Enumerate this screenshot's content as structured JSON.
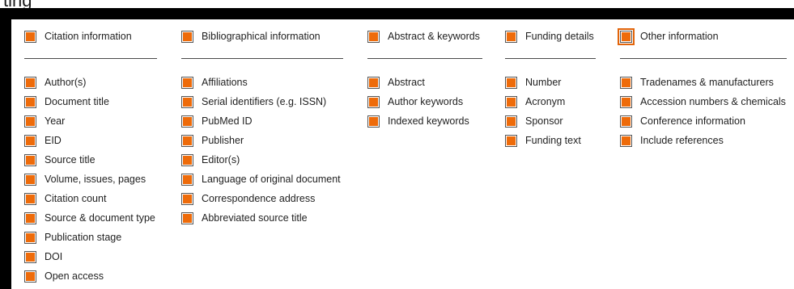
{
  "page": {
    "heading": "ting"
  },
  "columns": [
    {
      "header": "Citation information",
      "items": [
        "Author(s)",
        "Document title",
        "Year",
        "EID",
        "Source title",
        "Volume, issues, pages",
        "Citation count",
        "Source & document type",
        "Publication stage",
        "DOI",
        "Open access"
      ]
    },
    {
      "header": "Bibliographical information",
      "items": [
        "Affiliations",
        "Serial identifiers (e.g. ISSN)",
        "PubMed ID",
        "Publisher",
        "Editor(s)",
        "Language of original document",
        "Correspondence address",
        "Abbreviated source title"
      ]
    },
    {
      "header": "Abstract & keywords",
      "items": [
        "Abstract",
        "Author keywords",
        "Indexed keywords"
      ]
    },
    {
      "header": "Funding details",
      "items": [
        "Number",
        "Acronym",
        "Sponsor",
        "Funding text"
      ]
    },
    {
      "header": "Other information",
      "items": [
        "Tradenames & manufacturers",
        "Accession numbers & chemicals",
        "Conference information",
        "Include references"
      ]
    }
  ],
  "colors": {
    "checkbox_fill": "#ee6b0a",
    "frame": "#000000",
    "focus_ring": "#e2640a"
  }
}
